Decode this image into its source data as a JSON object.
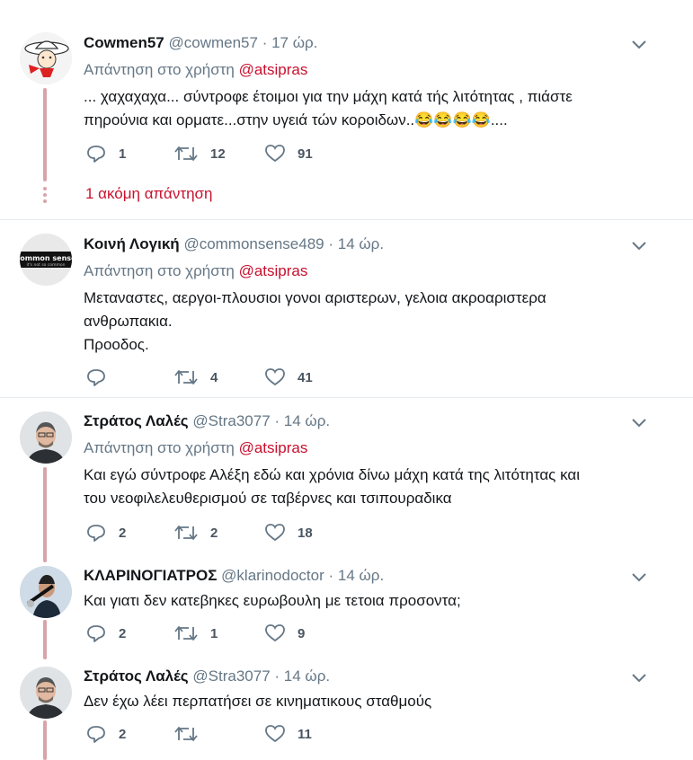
{
  "colors": {
    "accent": "#c8102e",
    "thread_line": "#d9a3ac",
    "muted": "#657786"
  },
  "tweets": [
    {
      "name": "Cowmen57",
      "handle": "@cowmen57",
      "time": "17 ώρ.",
      "reply_prefix": "Απάντηση στο χρήστη",
      "reply_to": "@atsipras",
      "text_lines": [
        "... χαχαχαχα... σύντροφε έτοιμοι για την μάχη κατά τής λιτότητας , πιάστε",
        "πηρούνια και ορματε...στην υγειά τών κοροιδων..😂😂😂😂...."
      ],
      "replies": "1",
      "retweets": "12",
      "likes": "91"
    },
    {
      "name": "Κοινή Λογική",
      "handle": "@commonsense489",
      "time": "14 ώρ.",
      "reply_prefix": "Απάντηση στο χρήστη",
      "reply_to": "@atsipras",
      "text_lines": [
        "Μεταναστες, αεργοι-πλουσιοι γονοι αριστερων, γελοια ακροαριστερα",
        "ανθρωπακια.",
        "Προοδος."
      ],
      "replies": "",
      "retweets": "4",
      "likes": "41",
      "avatar_text": "common sense",
      "avatar_subtext": "it's not so common"
    },
    {
      "name": "Στράτος Λαλές",
      "handle": "@Stra3077",
      "time": "14 ώρ.",
      "reply_prefix": "Απάντηση στο χρήστη",
      "reply_to": "@atsipras",
      "text_lines": [
        "Και εγώ σύντροφε Αλέξη εδώ και χρόνια δίνω μάχη κατά της λιτότητας και",
        "του νεοφιλελευθερισμού σε ταβέρνες και τσιπουραδικα"
      ],
      "replies": "2",
      "retweets": "2",
      "likes": "18"
    },
    {
      "name": "ΚΛΑΡΙΝΟΓΙΑΤΡΟΣ",
      "handle": "@klarinodoctor",
      "time": "14 ώρ.",
      "text_lines": [
        "Και γιατι δεν κατεβηκες ευρωβουλη με τετοια προσοντα;"
      ],
      "replies": "2",
      "retweets": "1",
      "likes": "9"
    },
    {
      "name": "Στράτος Λαλές",
      "handle": "@Stra3077",
      "time": "14 ώρ.",
      "text_lines": [
        "Δεν έχω λέει περπατήσει σε κινηματικους σταθμούς"
      ],
      "replies": "2",
      "retweets": "",
      "likes": "11"
    }
  ],
  "more_replies_label": "1 ακόμη απάντηση",
  "dot_separator": "·"
}
